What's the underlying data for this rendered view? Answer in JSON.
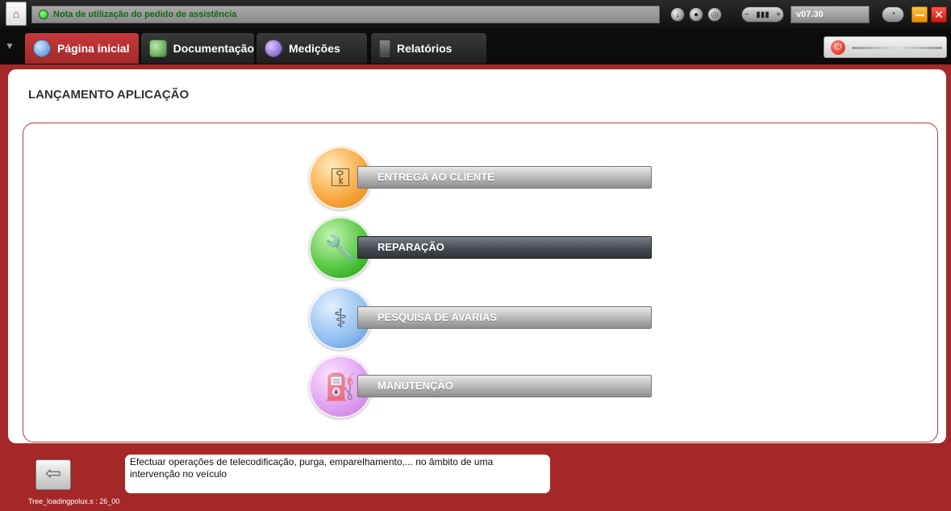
{
  "titlebar": {
    "notice": "Nota de utilização do pedido de assistência",
    "version": "v07.30"
  },
  "tabs": [
    {
      "label": "Página inicial",
      "icon": "home-icon",
      "active": true
    },
    {
      "label": "Documentação",
      "icon": "book-icon",
      "active": false
    },
    {
      "label": "Medições",
      "icon": "waveform-icon",
      "active": false
    },
    {
      "label": "Relatórios",
      "icon": "report-icon",
      "active": false
    }
  ],
  "main": {
    "title": "LANÇAMENTO APLICAÇÃO",
    "menu": [
      {
        "label": "ENTREGA AO CLIENTE",
        "icon": "key-icon",
        "color": "#f8a53a"
      },
      {
        "label": "REPARAÇÃO",
        "icon": "wrench-icon",
        "color": "#4ec43a",
        "selected": true
      },
      {
        "label": "PESQUISA DE AVARIAS",
        "icon": "stethoscope-icon",
        "color": "#8fbef0"
      },
      {
        "label": "MANUTENÇÃO",
        "icon": "oil-can-icon",
        "color": "#df9ef0"
      }
    ]
  },
  "footer": {
    "info": "Efectuar operações de telecodificação, purga, emparelhamento,... no âmbito de uma intervenção no veículo",
    "status": "Tree_loadingpolux.s : 26_00"
  },
  "colors": {
    "brand_red": "#a42828",
    "active_tab": "#c43a3a",
    "selected_bar": "#3a3f46"
  }
}
